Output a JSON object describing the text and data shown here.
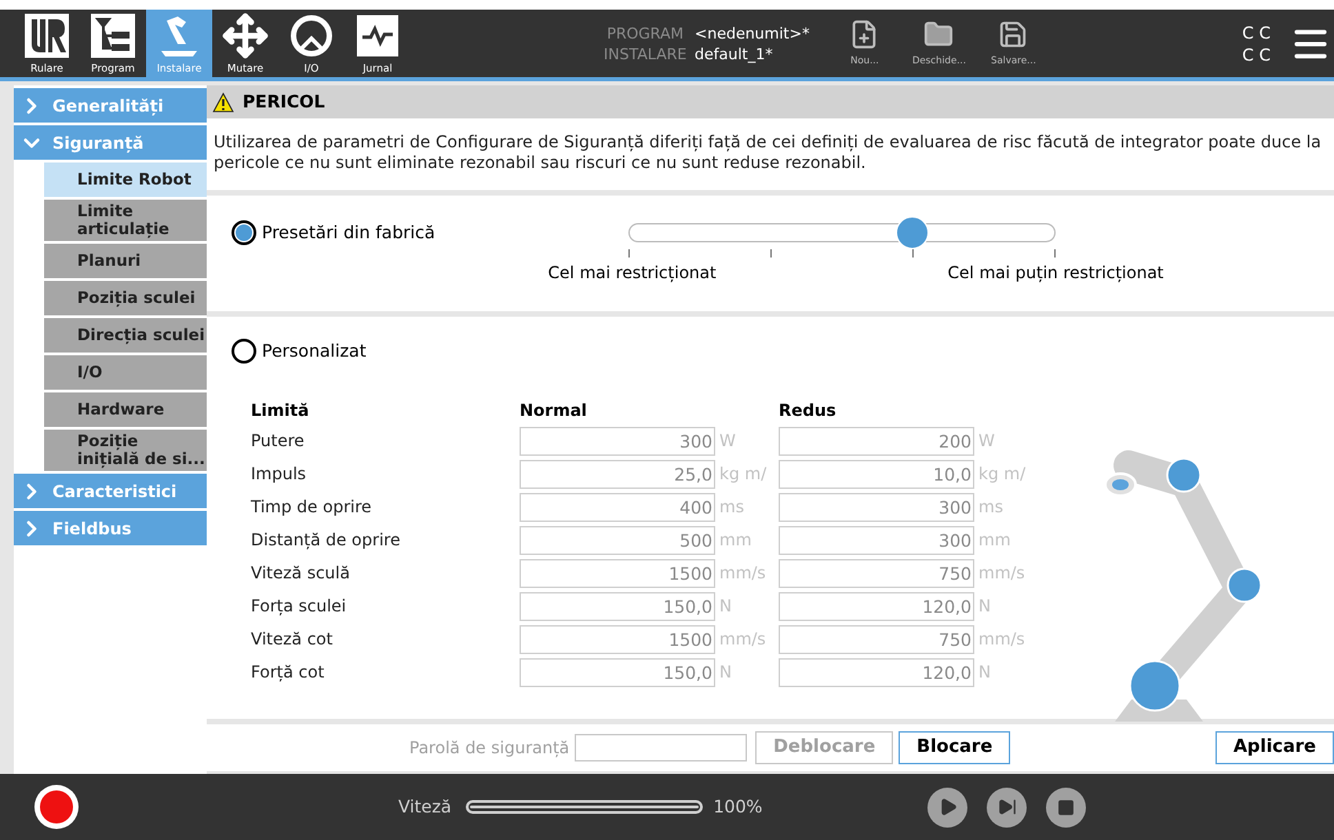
{
  "top_bar": {
    "tabs": [
      {
        "kind": "run",
        "label": "Rulare",
        "selected": false
      },
      {
        "kind": "program",
        "label": "Program",
        "selected": false
      },
      {
        "kind": "install",
        "label": "Instalare",
        "selected": true
      },
      {
        "kind": "move",
        "label": "Mutare",
        "selected": false
      },
      {
        "kind": "io",
        "label": "I/O",
        "selected": false
      },
      {
        "kind": "log",
        "label": "Jurnal",
        "selected": false
      }
    ],
    "files": [
      {
        "label": "PROGRAM",
        "value": "<nedenumit>*"
      },
      {
        "label": "INSTALARE",
        "value": "default_1*"
      }
    ],
    "file_buttons": [
      {
        "kind": "new",
        "label": "Nou..."
      },
      {
        "kind": "open",
        "label": "Deschide..."
      },
      {
        "kind": "save",
        "label": "Salvare..."
      }
    ],
    "status_letters": [
      "C C",
      "C C"
    ]
  },
  "sidebar": {
    "items": [
      {
        "label": "Generalități",
        "expanded": false
      },
      {
        "label": "Siguranță",
        "expanded": true,
        "children": [
          {
            "label": "Limite Robot",
            "selected": true
          },
          {
            "label": "Limite articulație",
            "selected": false
          },
          {
            "label": "Planuri",
            "selected": false
          },
          {
            "label": "Poziția sculei",
            "selected": false
          },
          {
            "label": "Direcția sculei",
            "selected": false
          },
          {
            "label": "I/O",
            "selected": false
          },
          {
            "label": "Hardware",
            "selected": false
          },
          {
            "label": "Poziție inițială de si...",
            "selected": false
          }
        ]
      },
      {
        "label": "Caracteristici",
        "expanded": false
      },
      {
        "label": "Fieldbus",
        "expanded": false
      }
    ]
  },
  "warning": {
    "title": "PERICOL",
    "text": "Utilizarea de parametri de Configurare de Siguranță diferiți față de cei definiți de evaluarea de risc făcută de integrator poate duce la pericole ce nu sunt eliminate rezonabil sau riscuri ce nu sunt reduse rezonabil."
  },
  "presets": {
    "label": "Presetări din fabrică",
    "selected": true,
    "level": 0.667,
    "min_label": "Cel mai restricționat",
    "max_label": "Cel mai puțin restricționat"
  },
  "custom": {
    "label": "Personalizat",
    "selected": false,
    "columns": [
      "Limită",
      "Normal",
      "Redus"
    ],
    "rows": [
      {
        "name": "Putere",
        "normal": "300",
        "normal_unit": "W",
        "reduced": "200",
        "reduced_unit": "W"
      },
      {
        "name": "Impuls",
        "normal": "25,0",
        "normal_unit": "kg m/",
        "reduced": "10,0",
        "reduced_unit": "kg m/"
      },
      {
        "name": "Timp de oprire",
        "normal": "400",
        "normal_unit": "ms",
        "reduced": "300",
        "reduced_unit": "ms"
      },
      {
        "name": "Distanță de oprire",
        "normal": "500",
        "normal_unit": "mm",
        "reduced": "300",
        "reduced_unit": "mm"
      },
      {
        "name": "Viteză sculă",
        "normal": "1500",
        "normal_unit": "mm/s",
        "reduced": "750",
        "reduced_unit": "mm/s"
      },
      {
        "name": "Forța sculei",
        "normal": "150,0",
        "normal_unit": "N",
        "reduced": "120,0",
        "reduced_unit": "N"
      },
      {
        "name": "Viteză cot",
        "normal": "1500",
        "normal_unit": "mm/s",
        "reduced": "750",
        "reduced_unit": "mm/s"
      },
      {
        "name": "Forță cot",
        "normal": "150,0",
        "normal_unit": "N",
        "reduced": "120,0",
        "reduced_unit": "N"
      }
    ]
  },
  "footer": {
    "password_label": "Parolă de siguranță",
    "unlock": {
      "label": "Deblocare",
      "disabled": true
    },
    "lock": {
      "label": "Blocare",
      "disabled": false
    },
    "apply": {
      "label": "Aplicare",
      "disabled": false
    }
  },
  "bottom_bar": {
    "speed_label": "Viteză",
    "speed_value": "100%",
    "speed_slider": {
      "level": 1
    }
  }
}
